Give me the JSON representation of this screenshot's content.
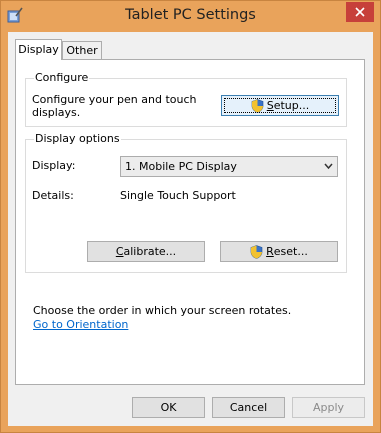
{
  "window": {
    "title": "Tablet PC Settings"
  },
  "tabs": [
    {
      "label": "Display"
    },
    {
      "label": "Other"
    }
  ],
  "configure": {
    "title": "Configure",
    "description_line1": "Configure your pen and touch",
    "description_line2": "displays.",
    "setup_button": {
      "accel": "S",
      "rest": "etup..."
    }
  },
  "display_options": {
    "title": "Display options",
    "display_label": "Display:",
    "display_value": "1. Mobile PC Display",
    "details_label": "Details:",
    "details_value": "Single Touch Support",
    "calibrate_button": {
      "accel": "C",
      "rest": "alibrate..."
    },
    "reset_button": {
      "accel": "R",
      "rest": "eset..."
    }
  },
  "orientation": {
    "text": "Choose the order in which your screen rotates.",
    "link": "Go to Orientation"
  },
  "footer": {
    "ok": "OK",
    "cancel": "Cancel",
    "apply": "Apply"
  },
  "colors": {
    "frame": "#e9a35b",
    "close_button": "#c7403a",
    "link": "#0066cc"
  }
}
